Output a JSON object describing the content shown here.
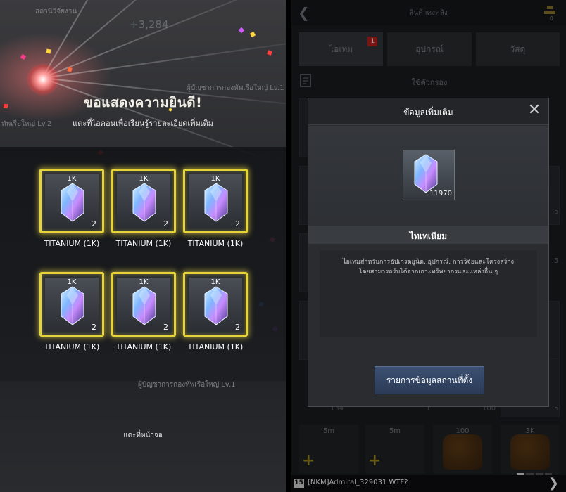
{
  "left": {
    "ghost_top_label": "สถานีวิจัยงาน",
    "ghost_number": "+3,284",
    "ghost_mid_label": "ผู้บัญชาการกองทัพเรือใหญ่ Lv.1",
    "ghost_left_label": "ทัพเรือใหญ่ Lv.2",
    "title": "ขอแสดงความยินดี!",
    "subtitle": "แตะที่ไอคอนเพื่อเรียนรู้รายละเอียดเพิ่มเติม",
    "rewards": [
      {
        "badge": "1K",
        "qty": "2",
        "label": "TITANIUM (1K)"
      },
      {
        "badge": "1K",
        "qty": "2",
        "label": "TITANIUM (1K)"
      },
      {
        "badge": "1K",
        "qty": "2",
        "label": "TITANIUM (1K)"
      },
      {
        "badge": "1K",
        "qty": "2",
        "label": "TITANIUM (1K)"
      },
      {
        "badge": "1K",
        "qty": "2",
        "label": "TITANIUM (1K)"
      },
      {
        "badge": "1K",
        "qty": "2",
        "label": "TITANIUM (1K)"
      }
    ],
    "ghost_bottom_label": "ผู้บัญชาการกองทัพเรือใหญ่ Lv.1",
    "tap_screen": "แตะที่หน้าจอ"
  },
  "right": {
    "top_title": "สินค้าคงคลัง",
    "gold_count": "0",
    "tabs": [
      {
        "label": "ไอเทม",
        "badge": "1"
      },
      {
        "label": "อุปกรณ์"
      },
      {
        "label": "วัสดุ"
      }
    ],
    "filter_label": "ใช้ตัวกรอง",
    "grid_numbers": [
      "134",
      "1",
      "100",
      "5",
      "5",
      "5"
    ],
    "bottom_items": [
      "5m",
      "5m",
      "100",
      "3K"
    ],
    "modal": {
      "title": "ข้อมูลเพิ่มเติม",
      "icon_count": "11970",
      "item_name": "ไทเทเนียม",
      "description_line1": "ไอเทมสำหรับการอัปเกรดยูนิต, อุปกรณ์, การวิจัยและโครงสร้าง",
      "description_line2": "โดยสามารถรับได้จากเกาะทรัพยากรและแหล่งอื่น ๆ",
      "action_label": "รายการข้อมูลสถานที่ตั้ง"
    },
    "chat": {
      "level": "15",
      "text": "[NKM]Admiral_329031 WTF?"
    }
  },
  "colors": {
    "gold_frame": "#e6d33a",
    "button_blue": "#3c5072",
    "badge_red": "#b72020"
  },
  "icons": [
    "titanium-crystal-icon",
    "back-arrow-icon",
    "close-icon",
    "filter-icon",
    "gold-bars-icon",
    "next-arrow-icon"
  ]
}
